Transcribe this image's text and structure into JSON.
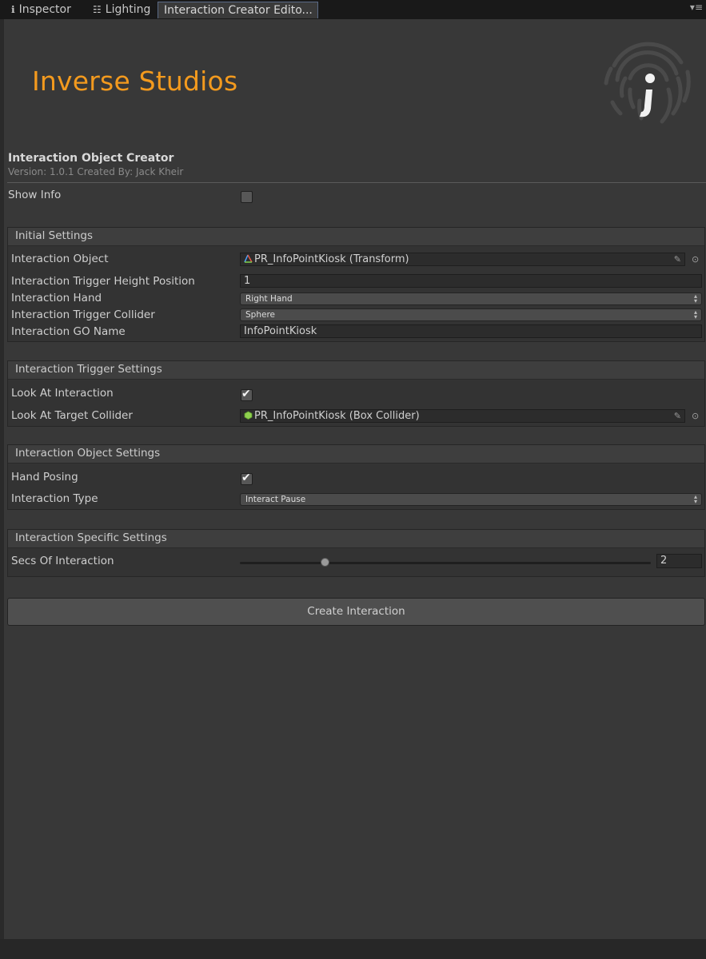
{
  "tabs": [
    {
      "label": "Inspector",
      "icon": "info-icon"
    },
    {
      "label": "Lighting",
      "icon": "lighting-sliders-icon"
    },
    {
      "label": "Interaction Creator Edito...",
      "icon": ""
    }
  ],
  "tab_menu_icon": "tab-menu-icon",
  "logo": {
    "text": "Inverse Studios",
    "color": "#f39a1e",
    "mark_icon": "fingerprint-i-logo"
  },
  "header": {
    "title": "Interaction Object Creator",
    "version": "Version: 1.0.1 Created By: Jack Kheir"
  },
  "show_info": {
    "label": "Show Info",
    "checked": false
  },
  "initial_settings": {
    "title": "Initial Settings",
    "interaction_object": {
      "label": "Interaction Object",
      "value": "PR_InfoPointKiosk (Transform)",
      "icon": "transform-icon"
    },
    "trigger_height": {
      "label": "Interaction Trigger Height Position",
      "value": "1"
    },
    "hand": {
      "label": "Interaction Hand",
      "value": "Right Hand"
    },
    "trigger_collider": {
      "label": "Interaction Trigger Collider",
      "value": "Sphere"
    },
    "go_name": {
      "label": "Interaction GO Name",
      "value": "InfoPointKiosk"
    }
  },
  "trigger_settings": {
    "title": "Interaction Trigger Settings",
    "look_at": {
      "label": "Look At Interaction",
      "checked": true
    },
    "look_target": {
      "label": "Look At Target Collider",
      "value": "PR_InfoPointKiosk (Box Collider)",
      "icon": "box-collider-icon"
    }
  },
  "object_settings": {
    "title": "Interaction Object Settings",
    "hand_posing": {
      "label": "Hand Posing",
      "checked": true
    },
    "type": {
      "label": "Interaction Type",
      "value": "Interact Pause"
    }
  },
  "specific_settings": {
    "title": "Interaction Specific Settings",
    "secs": {
      "label": "Secs Of Interaction",
      "value": "2"
    }
  },
  "create_button": {
    "label": "Create Interaction"
  }
}
